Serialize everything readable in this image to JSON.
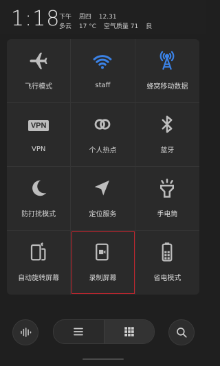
{
  "status": {
    "time": "1:18",
    "period": "下午",
    "weekday": "周四",
    "date": "12.31",
    "weather": "多云",
    "temperature": "17 °C",
    "air_quality_label": "空气质量 71",
    "air_quality_level": "良"
  },
  "toggles": [
    {
      "label": "飞行模式",
      "icon": "airplane-icon",
      "active": false
    },
    {
      "label": "staff",
      "icon": "wifi-icon",
      "active": true
    },
    {
      "label": "蜂窝移动数据",
      "icon": "cellular-tower-icon",
      "active": true
    },
    {
      "label": "VPN",
      "icon": "vpn-icon",
      "icon_text": "VPN",
      "active": false
    },
    {
      "label": "个人热点",
      "icon": "hotspot-icon",
      "active": false
    },
    {
      "label": "蓝牙",
      "icon": "bluetooth-icon",
      "active": false
    },
    {
      "label": "防打扰模式",
      "icon": "moon-icon",
      "active": false
    },
    {
      "label": "定位服务",
      "icon": "location-arrow-icon",
      "active": false
    },
    {
      "label": "手电筒",
      "icon": "flashlight-icon",
      "active": false
    },
    {
      "label": "自动旋转屏幕",
      "icon": "rotate-screen-icon",
      "active": false
    },
    {
      "label": "录制屏幕",
      "icon": "screen-record-icon",
      "active": false,
      "highlighted": true
    },
    {
      "label": "省电模式",
      "icon": "battery-saver-icon",
      "active": false
    }
  ],
  "colors": {
    "accent": "#3b82e6",
    "highlight_border": "#c0262e",
    "icon_default": "#bdbdbd"
  },
  "bottom": {
    "left_icon": "audio-wave-icon",
    "segment_left_icon": "list-icon",
    "segment_right_icon": "grid-icon",
    "right_icon": "search-icon"
  }
}
